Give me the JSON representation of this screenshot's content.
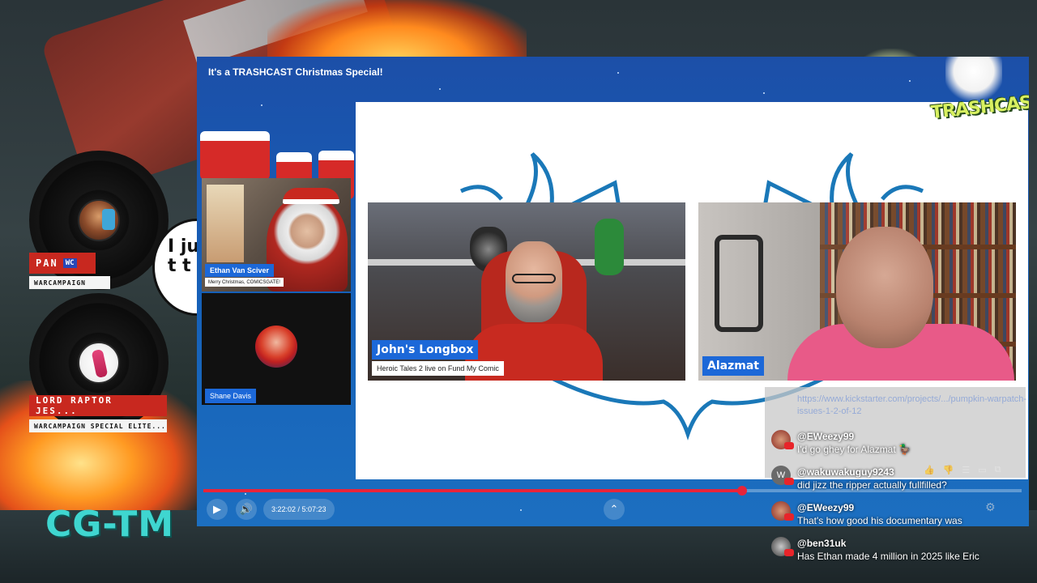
{
  "player": {
    "title": "It's a TRASHCAST Christmas Special!",
    "time_display": "3:22:02 / 5:07:23",
    "progress_fraction": 0.6583,
    "logo_text": "TRASHCAST"
  },
  "participants": [
    {
      "name": "Ethan Van Sciver",
      "subtitle": "Merry Christmas, COMICSGATE!"
    },
    {
      "name": "Shane Davis"
    },
    {
      "name": "John's Longbox",
      "subtitle": "Heroic Tales 2 live on Fund My Comic"
    },
    {
      "name": "Alazmat"
    }
  ],
  "overlay": {
    "pan": {
      "name": "PAN",
      "badge": "WC",
      "subtitle": "WARCAMPAIGN"
    },
    "raptor": {
      "name": "LORD RAPTOR JES...",
      "subtitle": "WARCAMPAIGN SPECIAL ELITE..."
    },
    "bubble_text": "I ju to t t",
    "bottom_logo": "CG-TM"
  },
  "chat": {
    "link_text": "https://www.kickstarter.com/projects/.../pumpkin-warpatch-issues-1-2-of-12",
    "messages": [
      {
        "user": "@EWeezy99",
        "text": "I'd go ghey for Alazmat 🦆",
        "avatar_letter": ""
      },
      {
        "user": "@wakuwakuguy9243",
        "text": "did jizz the ripper actually fullfilled?",
        "avatar_letter": "W"
      },
      {
        "user": "@EWeezy99",
        "text": "That's how good his documentary was",
        "avatar_letter": ""
      },
      {
        "user": "@ben31uk",
        "text": "Has Ethan made 4 million in 2025 like Eric",
        "avatar_letter": ""
      }
    ]
  },
  "colors": {
    "accent_red": "#e8243a",
    "lower_third_blue": "#1c68d8",
    "player_blue": "#1660b8"
  },
  "icons": {
    "play": "play-icon",
    "volume": "volume-icon",
    "expand": "chevron-up-icon",
    "gear": "gear-icon"
  }
}
